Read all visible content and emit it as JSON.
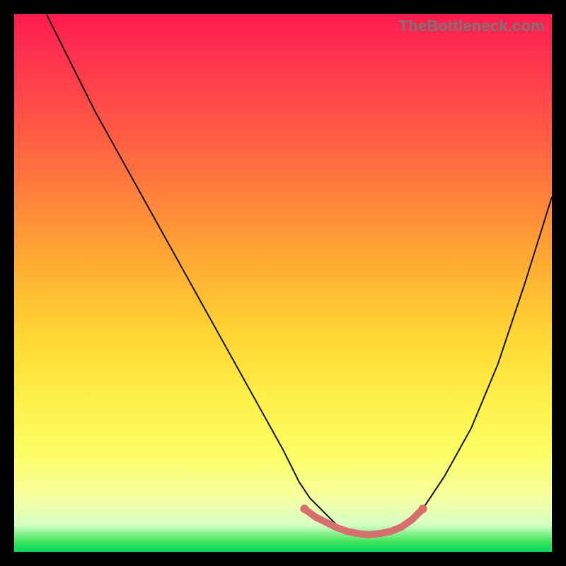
{
  "watermark": "TheBottleneck.com",
  "chart_data": {
    "type": "line",
    "title": "",
    "xlabel": "",
    "ylabel": "",
    "xlim": [
      0,
      100
    ],
    "ylim": [
      0,
      100
    ],
    "grid": false,
    "legend": false,
    "series": [
      {
        "name": "bottleneck-curve",
        "color": "#111111",
        "x": [
          6,
          10,
          15,
          20,
          25,
          30,
          35,
          40,
          45,
          50,
          53,
          55,
          58,
          60,
          63,
          65,
          68,
          70,
          73,
          76,
          80,
          85,
          90,
          95,
          100
        ],
        "y": [
          100,
          92,
          82,
          73,
          64,
          55,
          46,
          37,
          28,
          19,
          13,
          10,
          7,
          5,
          3.5,
          3,
          3,
          3.5,
          5,
          8,
          14,
          23,
          35,
          50,
          66
        ]
      },
      {
        "name": "optimal-range-highlight",
        "color": "#d86e6e",
        "x": [
          54,
          56,
          58,
          60,
          62,
          64,
          66,
          68,
          70,
          72,
          74,
          76
        ],
        "y": [
          8,
          6.5,
          5.5,
          4.5,
          3.8,
          3.4,
          3.2,
          3.4,
          3.8,
          4.6,
          6.0,
          8
        ]
      }
    ],
    "annotations": []
  }
}
